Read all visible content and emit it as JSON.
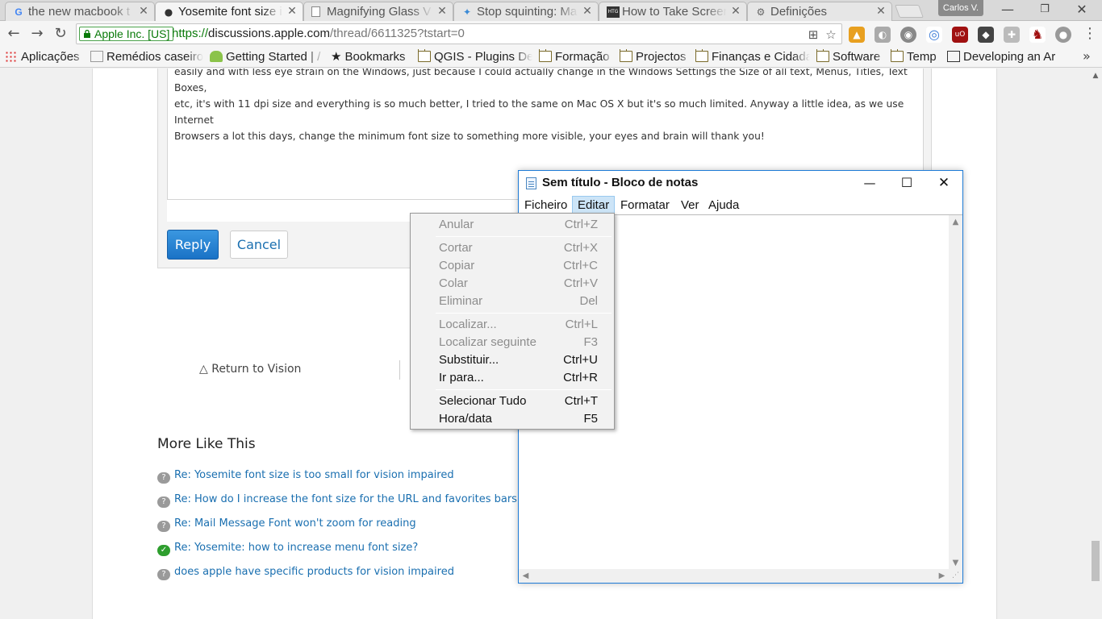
{
  "tabs": [
    {
      "title": "the new macbook t",
      "icon": "google-icon"
    },
    {
      "title": "Yosemite font size i",
      "icon": "apple-icon",
      "active": true
    },
    {
      "title": "Magnifying Glass V",
      "icon": "page-icon"
    },
    {
      "title": "Stop squinting: Ma",
      "icon": "page-icon"
    },
    {
      "title": "How to Take Screen",
      "icon": "htg-icon",
      "icon_text": "HTG"
    },
    {
      "title": "Definições",
      "icon": "gear-icon"
    }
  ],
  "profile_name": "Carlos V.",
  "toolbar": {
    "secure_label": "Apple Inc. [US]",
    "url_scheme": "https://",
    "url_host": "discussions.apple.com",
    "url_path": "/thread/6611325?tstart=0"
  },
  "bookmarks": [
    {
      "label": "Aplicações",
      "icon": "apps-grid-icon"
    },
    {
      "label": "Remédios caseiros",
      "icon": "site-icon"
    },
    {
      "label": "Getting Started | /",
      "icon": "android-icon"
    },
    {
      "label": "Bookmarks",
      "icon": "star-icon"
    },
    {
      "label": "QGIS - Plugins De",
      "icon": "folder-icon"
    },
    {
      "label": "Formação",
      "icon": "folder-icon"
    },
    {
      "label": "Projectos",
      "icon": "folder-icon"
    },
    {
      "label": "Finanças e Cidada",
      "icon": "folder-icon"
    },
    {
      "label": "Software",
      "icon": "folder-icon"
    },
    {
      "label": "Temp",
      "icon": "folder-icon"
    },
    {
      "label": "Developing an Ar",
      "icon": "site-icon"
    }
  ],
  "page": {
    "editor_lines": [
      "easily and with less eye strain on the Windows, just because I could actually change in the Windows Settings the Size of all text, Menus, Titles, Text Boxes,",
      "etc, it's with 11 dpi size and everything is so much better, I tried to the same on Mac OS X but it's so much limited. Anyway a little idea, as we use Internet",
      "Browsers a lot this days, change the minimum font size to something more visible, your eyes and brain will thank you!"
    ],
    "reply_label": "Reply",
    "cancel_label": "Cancel",
    "return_link": "Return to Vision",
    "more_title": "More Like This",
    "more_items": [
      {
        "text": "Re: Yosemite font size is too small for vision impaired",
        "answered": false
      },
      {
        "text": "Re: How do I increase the font size for the URL and favorites bars in",
        "answered": false
      },
      {
        "text": "Re: Mail Message Font won't zoom for reading",
        "answered": false
      },
      {
        "text": "Re: Yosemite: how to increase menu font size?",
        "answered": true
      },
      {
        "text": "does apple have specific products for vision impaired",
        "answered": false
      }
    ]
  },
  "notepad": {
    "title": "Sem título - Bloco de notas",
    "menus": [
      "Ficheiro",
      "Editar",
      "Formatar",
      "Ver",
      "Ajuda"
    ],
    "open_menu": "Editar"
  },
  "edit_menu": {
    "items": [
      {
        "label": "Anular",
        "shortcut": "Ctrl+Z",
        "enabled": false
      },
      {
        "separator": true
      },
      {
        "label": "Cortar",
        "shortcut": "Ctrl+X",
        "enabled": false
      },
      {
        "label": "Copiar",
        "shortcut": "Ctrl+C",
        "enabled": false
      },
      {
        "label": "Colar",
        "shortcut": "Ctrl+V",
        "enabled": false
      },
      {
        "label": "Eliminar",
        "shortcut": "Del",
        "enabled": false
      },
      {
        "separator": true
      },
      {
        "label": "Localizar...",
        "shortcut": "Ctrl+L",
        "enabled": false
      },
      {
        "label": "Localizar seguinte",
        "shortcut": "F3",
        "enabled": false
      },
      {
        "label": "Substituir...",
        "shortcut": "Ctrl+U",
        "enabled": true
      },
      {
        "label": "Ir para...",
        "shortcut": "Ctrl+R",
        "enabled": true
      },
      {
        "separator": true
      },
      {
        "label": "Selecionar Tudo",
        "shortcut": "Ctrl+T",
        "enabled": true
      },
      {
        "label": "Hora/data",
        "shortcut": "F5",
        "enabled": true
      }
    ]
  },
  "colors": {
    "secure_green": "#0a7a0a",
    "link_blue": "#1a6fb0",
    "reply_blue": "#1a72c6",
    "window_border": "#1e7bd6",
    "menu_highlight": "#cce4f7"
  }
}
